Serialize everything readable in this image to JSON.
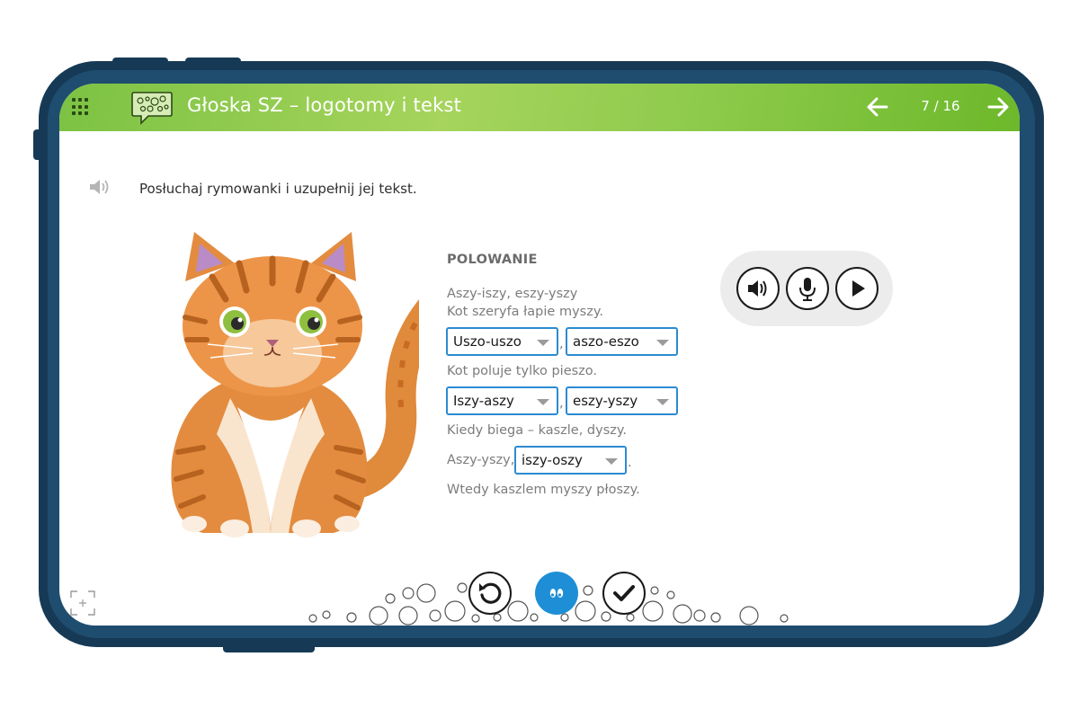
{
  "header": {
    "title": "Głoska SZ – logotomy i tekst",
    "page": "7 / 16"
  },
  "instruction": "Posłuchaj rymowanki i uzupełnij jej tekst.",
  "poem": {
    "title": "POLOWANIE",
    "line1": "Aszy-iszy, eszy-yszy",
    "line2": "Kot szeryfa łapie myszy.",
    "dropdown1": "Uszo-uszo",
    "dropdown2": "aszo-eszo",
    "line3": "Kot poluje tylko pieszo.",
    "dropdown3": "Iszy-aszy",
    "dropdown4": "eszy-yszy",
    "line4": "Kiedy biega – kaszle, dyszy.",
    "line5_prefix": "Aszy-yszy,",
    "dropdown5": "iszy-oszy",
    "line6": "Wtedy kaszlem myszy płoszy.",
    "comma": ",",
    "period": "."
  },
  "icons": {
    "menu": "grid-icon",
    "logo": "speech-bubble-logo-icon",
    "prev": "arrow-left-icon",
    "next": "arrow-right-icon",
    "speaker": "speaker-icon",
    "play_audio": "speaker-icon",
    "record": "microphone-icon",
    "play": "play-icon",
    "reset": "reset-icon",
    "hint": "eyes-icon",
    "check": "check-icon",
    "expand": "expand-icon"
  },
  "colors": {
    "header_green": "#8fcb4d",
    "frame": "#163a56",
    "dropdown_border": "#2b8bd1",
    "hint_button": "#1e8fd6"
  }
}
